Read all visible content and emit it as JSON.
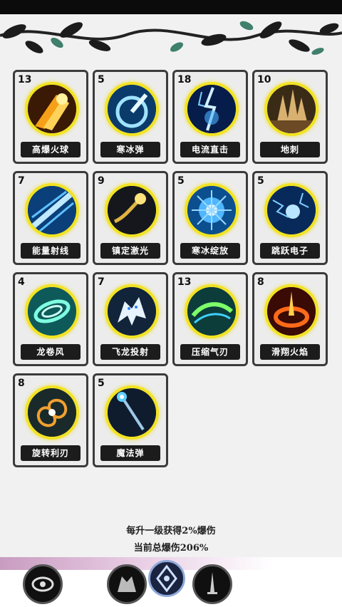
{
  "skills": [
    {
      "level": "13",
      "name": "高爆火球",
      "icon": "fireball-icon"
    },
    {
      "level": "5",
      "name": "寒冰弹",
      "icon": "ice-bullet-icon"
    },
    {
      "level": "18",
      "name": "电流直击",
      "icon": "lightning-strike-icon"
    },
    {
      "level": "10",
      "name": "地刺",
      "icon": "ground-spike-icon"
    },
    {
      "level": "7",
      "name": "能量射线",
      "icon": "energy-ray-icon"
    },
    {
      "level": "9",
      "name": "镇定激光",
      "icon": "laser-icon"
    },
    {
      "level": "5",
      "name": "寒冰绽放",
      "icon": "ice-bloom-icon"
    },
    {
      "level": "5",
      "name": "跳跃电子",
      "icon": "jumping-electron-icon"
    },
    {
      "level": "4",
      "name": "龙卷风",
      "icon": "tornado-icon"
    },
    {
      "level": "7",
      "name": "飞龙投射",
      "icon": "flying-dragon-icon"
    },
    {
      "level": "13",
      "name": "压缩气刃",
      "icon": "air-blade-icon"
    },
    {
      "level": "8",
      "name": "滑翔火焰",
      "icon": "flame-ring-icon"
    },
    {
      "level": "8",
      "name": "旋转利刃",
      "icon": "spinning-blade-icon"
    },
    {
      "level": "5",
      "name": "魔法弹",
      "icon": "magic-bullet-icon"
    }
  ],
  "info": {
    "line1": "每升一级获得2%爆伤",
    "line2": "当前总爆伤206%"
  },
  "colors": {
    "frame": "#3b3b3b",
    "ring": "#f2e322",
    "label_bg": "#1c1c1c"
  }
}
